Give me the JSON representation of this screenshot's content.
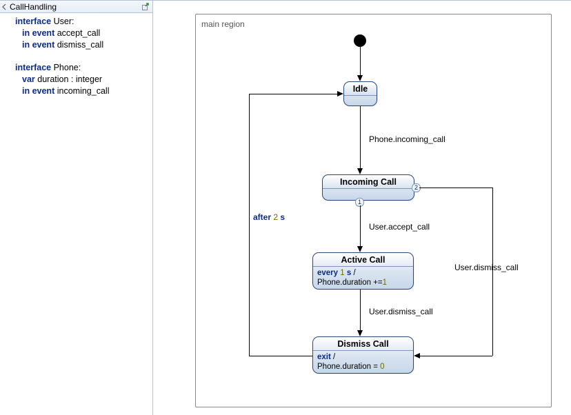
{
  "definition": {
    "header": "CallHandling",
    "interfaces": [
      {
        "keyword": "interface",
        "name": "User",
        "members": [
          {
            "qualifier": "in event",
            "name": "accept_call"
          },
          {
            "qualifier": "in event",
            "name": "dismiss_call"
          }
        ]
      },
      {
        "keyword": "interface",
        "name": "Phone",
        "members": [
          {
            "qualifier": "var",
            "name": "duration : integer"
          },
          {
            "qualifier": "in event",
            "name": "incoming_call"
          }
        ]
      }
    ]
  },
  "diagram": {
    "region_label": "main region",
    "states": {
      "idle": {
        "title": "Idle"
      },
      "incoming": {
        "title": "Incoming Call"
      },
      "active": {
        "title": "Active Call",
        "action_kw": "every",
        "action_time_num": "1",
        "action_time_unit": "s",
        "action_sep": "/",
        "action_eff": "Phone.duration +=",
        "action_eff_num": "1"
      },
      "dismiss": {
        "title": "Dismiss Call",
        "action_kw": "exit",
        "action_sep": "/",
        "action_eff": "Phone.duration =",
        "action_eff_num": "0"
      }
    },
    "badges": {
      "incoming_out": "1",
      "incoming_out2": "2"
    },
    "transitions": {
      "idle_incoming": "Phone.incoming_call",
      "incoming_active": "User.accept_call",
      "active_dismiss": "User.dismiss_call",
      "incoming_dismiss": "User.dismiss_call",
      "dismiss_idle_kw": "after",
      "dismiss_idle_num": "2",
      "dismiss_idle_unit": "s"
    }
  }
}
